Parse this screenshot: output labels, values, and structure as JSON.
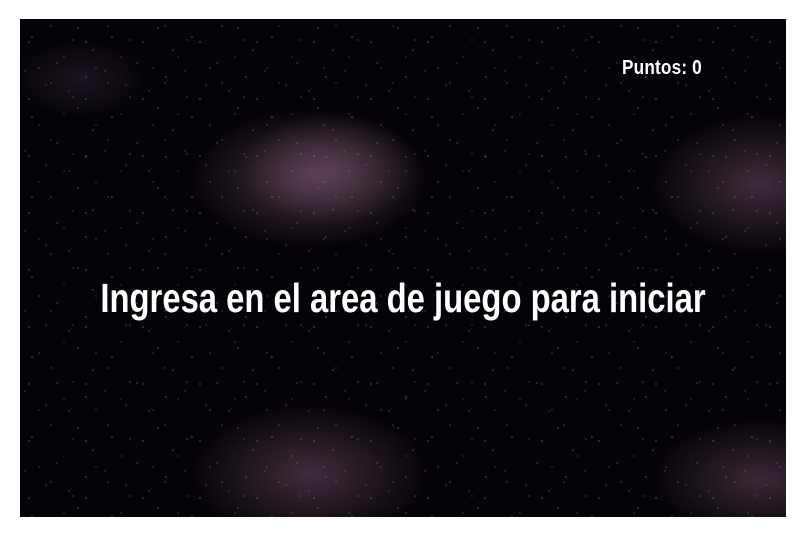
{
  "game": {
    "score_label": "Puntos: 0",
    "start_message": "Ingresa en el area de juego para iniciar"
  },
  "colors": {
    "page_background": "#ffffff",
    "game_background": "#050307",
    "text": "#ffffff"
  }
}
